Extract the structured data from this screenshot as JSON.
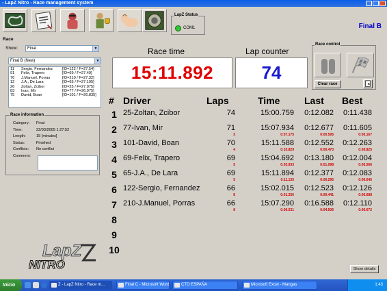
{
  "window": {
    "title": "- LapZ Nitro - Race management system"
  },
  "status": {
    "label": "LapZ Status",
    "port": "COM1"
  },
  "final_label": "Final B",
  "race_panel": {
    "title": "Race",
    "show_label": "Show:",
    "show_value": "Final",
    "race_select": "Final B (New)",
    "entries": [
      {
        "no": "11",
        "name": "Sergio, Fernandez",
        "info": "[ID=122 / F=27.54]"
      },
      {
        "no": "91",
        "name": "Felix, Trapero",
        "info": "[ID=69 / F=27.49]"
      },
      {
        "no": "76",
        "name": "J.Manuel, Porras",
        "info": "[ID=210 / F=27.32]"
      },
      {
        "no": "12",
        "name": "J.A., De Lara",
        "info": "[ID=65 / F=27.195]"
      },
      {
        "no": "26",
        "name": "Zoltan, Zcibor",
        "info": "[ID=25 / F=27.075]"
      },
      {
        "no": "83",
        "name": "Ivan, Mir",
        "info": "[ID=77 / F=26.975]"
      },
      {
        "no": "75",
        "name": "David, Boan",
        "info": "[ID=101 / F=26.835]"
      }
    ]
  },
  "race_info": {
    "title": "Race information",
    "rows": [
      {
        "k": "Category:",
        "v": "Final"
      },
      {
        "k": "Time:",
        "v": "22/03/2005 1:27:52"
      },
      {
        "k": "Length:",
        "v": "15 [minutes]"
      },
      {
        "k": "Status:",
        "v": "Finished"
      },
      {
        "k": "Conflicts:",
        "v": "No conflict"
      },
      {
        "k": "Comment:",
        "v": ""
      }
    ]
  },
  "logo": {
    "line1": "LapZ",
    "line2": "NITRO"
  },
  "race_time": {
    "label": "Race time",
    "value": "15:11.892"
  },
  "lap_counter": {
    "label": "Lap counter",
    "value": "74"
  },
  "race_control": {
    "title": "Race control",
    "clear": "Clear race"
  },
  "table": {
    "headers": {
      "pos": "#",
      "driver": "Driver",
      "laps": "Laps",
      "time": "Time",
      "last": "Last",
      "best": "Best"
    },
    "rows": [
      {
        "pos": "1",
        "driver": "25-Zoltan, Zcibor",
        "laps": "74",
        "time": "15:00.759",
        "last": "0:12.082",
        "best": "0:11.438",
        "laps_sub": "",
        "time_sub": "",
        "last_sub": "",
        "best_sub": ""
      },
      {
        "pos": "2",
        "driver": "77-Ivan, Mir",
        "laps": "71",
        "time": "15:07.934",
        "last": "0:12.677",
        "best": "0:11.605",
        "laps_sub": "3",
        "time_sub": "0:07.175",
        "last_sub": "0:00.595",
        "best_sub": "0:00.167"
      },
      {
        "pos": "3",
        "driver": "101-David, Boan",
        "laps": "70",
        "time": "15:11.588",
        "last": "0:12.552",
        "best": "0:12.263",
        "laps_sub": "4",
        "time_sub": "0:10.829",
        "last_sub": "0:00.470",
        "best_sub": "0:00.825"
      },
      {
        "pos": "4",
        "driver": "69-Felix, Trapero",
        "laps": "69",
        "time": "15:04.692",
        "last": "0:13.180",
        "best": "0:12.004",
        "laps_sub": "5",
        "time_sub": "0:03.933",
        "last_sub": "0:01.098",
        "best_sub": "0:00.566"
      },
      {
        "pos": "5",
        "driver": "65-J.A., De Lara",
        "laps": "69",
        "time": "15:11.894",
        "last": "0:12.377",
        "best": "0:12.083",
        "laps_sub": "5",
        "time_sub": "0:11.135",
        "last_sub": "0:00.295",
        "best_sub": "0:00.645"
      },
      {
        "pos": "6",
        "driver": "122-Sergio, Fernandez",
        "laps": "66",
        "time": "15:02.015",
        "last": "0:12.523",
        "best": "0:12.126",
        "laps_sub": "8",
        "time_sub": "0:01.256",
        "last_sub": "0:00.441",
        "best_sub": "0:00.688"
      },
      {
        "pos": "7",
        "driver": "210-J.Manuel, Porras",
        "laps": "66",
        "time": "15:07.290",
        "last": "0:16.588",
        "best": "0:12.110",
        "laps_sub": "8",
        "time_sub": "0:06.531",
        "last_sub": "0:04.506",
        "best_sub": "0:00.672"
      },
      {
        "pos": "8",
        "driver": "",
        "laps": "",
        "time": "",
        "last": "",
        "best": "",
        "laps_sub": "",
        "time_sub": "",
        "last_sub": "",
        "best_sub": ""
      },
      {
        "pos": "9",
        "driver": "",
        "laps": "",
        "time": "",
        "last": "",
        "best": "",
        "laps_sub": "",
        "time_sub": "",
        "last_sub": "",
        "best_sub": ""
      },
      {
        "pos": "10",
        "driver": "",
        "laps": "",
        "time": "",
        "last": "",
        "best": "",
        "laps_sub": "",
        "time_sub": "",
        "last_sub": "",
        "best_sub": ""
      }
    ]
  },
  "show_details": "Show details",
  "taskbar": {
    "start": "Inicio",
    "tasks": [
      {
        "label": "Z - LapZ Nitro - Race m...",
        "active": true
      },
      {
        "label": "Final C - Microsoft Word",
        "active": false
      },
      {
        "label": "CTO ESPAÑA",
        "active": false
      },
      {
        "label": "Microsoft Excel - Mangas",
        "active": false
      }
    ],
    "clock": "1:43"
  },
  "colors": {
    "race_time": "#e00000",
    "lap_counter": "#1a1ad0",
    "final_label": "#0000cc",
    "sub_values": "#d00000"
  }
}
